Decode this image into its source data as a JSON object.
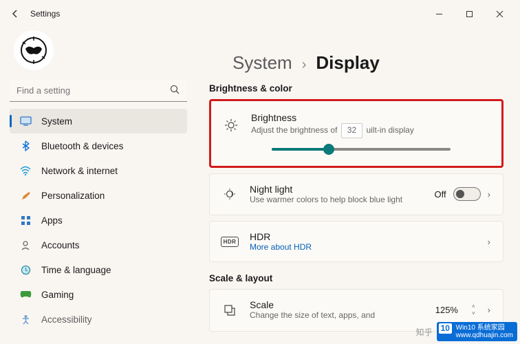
{
  "titlebar": {
    "title": "Settings"
  },
  "search": {
    "placeholder": "Find a setting"
  },
  "nav": [
    {
      "label": "System",
      "icon": "system",
      "active": true
    },
    {
      "label": "Bluetooth & devices",
      "icon": "bluetooth"
    },
    {
      "label": "Network & internet",
      "icon": "network"
    },
    {
      "label": "Personalization",
      "icon": "personalization"
    },
    {
      "label": "Apps",
      "icon": "apps"
    },
    {
      "label": "Accounts",
      "icon": "accounts"
    },
    {
      "label": "Time & language",
      "icon": "time"
    },
    {
      "label": "Gaming",
      "icon": "gaming"
    },
    {
      "label": "Accessibility",
      "icon": "accessibility"
    }
  ],
  "breadcrumb": {
    "parent": "System",
    "current": "Display"
  },
  "sections": {
    "brightness": {
      "heading": "Brightness & color",
      "title": "Brightness",
      "subtitle_before": "Adjust the brightness of",
      "subtitle_after": "uilt-in display",
      "value": "32",
      "slider_percent": 32
    },
    "nightlight": {
      "title": "Night light",
      "subtitle": "Use warmer colors to help block blue light",
      "state": "Off"
    },
    "hdr": {
      "badge": "HDR",
      "title": "HDR",
      "link": "More about HDR"
    },
    "scale": {
      "heading": "Scale & layout",
      "title": "Scale",
      "subtitle": "Change the size of text, apps, and",
      "value": "125%"
    }
  },
  "watermark": {
    "zhihu": "知乎",
    "brand_top": "Win10 系统家园",
    "brand_bottom": "www.qdhuajin.com"
  }
}
